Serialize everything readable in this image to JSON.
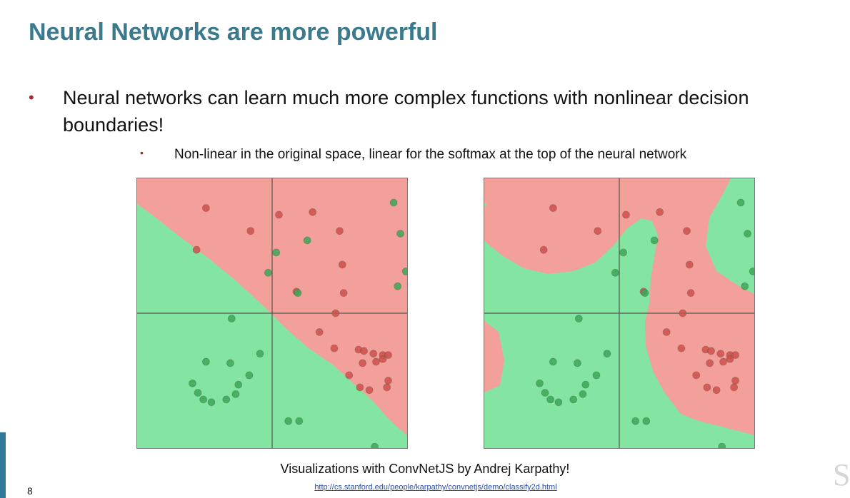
{
  "slide": {
    "title": "Neural Networks are more powerful",
    "bullet_main": "Neural networks can learn much more complex functions with nonlinear decision boundaries!",
    "bullet_sub": "Non-linear in the original space, linear for the softmax at the top of the neural network",
    "caption": "Visualizations with ConvNetJS by Andrej Karpathy!",
    "url": "http://cs.stanford.edu/people/karpathy/convnetjs/demo/classify2d.html",
    "page_number": "8",
    "corner_logo": "S"
  },
  "colors": {
    "title": "#3a7a8c",
    "red_region": "#f2a099",
    "green_region": "#84e5a2",
    "red_point": "#d0504a",
    "green_point": "#3aa856"
  },
  "chart_data": [
    {
      "type": "scatter",
      "title": "",
      "xlim": [
        -1,
        1
      ],
      "ylim": [
        -1,
        1
      ],
      "axes_lines": true,
      "decision_boundary": "linear",
      "series": [
        {
          "class": "red",
          "points": [
            [
              -0.49,
              0.78
            ],
            [
              -0.16,
              0.61
            ],
            [
              -0.56,
              0.47
            ],
            [
              0.05,
              0.73
            ],
            [
              0.3,
              0.75
            ],
            [
              0.5,
              0.61
            ],
            [
              0.52,
              0.36
            ],
            [
              0.53,
              0.15
            ],
            [
              0.18,
              0.16
            ],
            [
              0.47,
              0.0
            ],
            [
              0.35,
              -0.14
            ],
            [
              0.46,
              -0.26
            ],
            [
              0.64,
              -0.27
            ],
            [
              0.68,
              -0.28
            ],
            [
              0.75,
              -0.3
            ],
            [
              0.82,
              -0.31
            ],
            [
              0.86,
              -0.31
            ],
            [
              0.82,
              -0.34
            ],
            [
              0.77,
              -0.36
            ],
            [
              0.67,
              -0.37
            ],
            [
              0.86,
              -0.5
            ],
            [
              0.57,
              -0.46
            ],
            [
              0.65,
              -0.55
            ],
            [
              0.72,
              -0.57
            ],
            [
              0.85,
              -0.55
            ]
          ]
        },
        {
          "class": "green",
          "points": [
            [
              0.9,
              0.82
            ],
            [
              0.95,
              0.59
            ],
            [
              0.99,
              0.31
            ],
            [
              0.93,
              0.2
            ],
            [
              0.26,
              0.54
            ],
            [
              0.03,
              0.45
            ],
            [
              -0.03,
              0.3
            ],
            [
              0.19,
              0.15
            ],
            [
              -0.3,
              -0.04
            ],
            [
              -0.09,
              -0.3
            ],
            [
              -0.49,
              -0.36
            ],
            [
              -0.31,
              -0.37
            ],
            [
              -0.17,
              -0.46
            ],
            [
              -0.59,
              -0.52
            ],
            [
              -0.55,
              -0.59
            ],
            [
              -0.51,
              -0.64
            ],
            [
              -0.45,
              -0.66
            ],
            [
              -0.34,
              -0.64
            ],
            [
              -0.27,
              -0.6
            ],
            [
              -0.25,
              -0.53
            ],
            [
              0.12,
              -0.8
            ],
            [
              0.2,
              -0.8
            ],
            [
              0.76,
              -0.99
            ]
          ]
        }
      ]
    },
    {
      "type": "scatter",
      "title": "",
      "xlim": [
        -1,
        1
      ],
      "ylim": [
        -1,
        1
      ],
      "axes_lines": true,
      "decision_boundary": "nonlinear",
      "series": [
        {
          "class": "red",
          "points": [
            [
              -0.49,
              0.78
            ],
            [
              -0.16,
              0.61
            ],
            [
              -0.56,
              0.47
            ],
            [
              0.05,
              0.73
            ],
            [
              0.3,
              0.75
            ],
            [
              0.5,
              0.61
            ],
            [
              0.52,
              0.36
            ],
            [
              0.53,
              0.15
            ],
            [
              0.18,
              0.16
            ],
            [
              0.47,
              0.0
            ],
            [
              0.35,
              -0.14
            ],
            [
              0.46,
              -0.26
            ],
            [
              0.64,
              -0.27
            ],
            [
              0.68,
              -0.28
            ],
            [
              0.75,
              -0.3
            ],
            [
              0.82,
              -0.31
            ],
            [
              0.86,
              -0.31
            ],
            [
              0.82,
              -0.34
            ],
            [
              0.77,
              -0.36
            ],
            [
              0.67,
              -0.37
            ],
            [
              0.86,
              -0.5
            ],
            [
              0.57,
              -0.46
            ],
            [
              0.65,
              -0.55
            ],
            [
              0.72,
              -0.57
            ],
            [
              0.85,
              -0.55
            ]
          ]
        },
        {
          "class": "green",
          "points": [
            [
              0.9,
              0.82
            ],
            [
              0.95,
              0.59
            ],
            [
              0.99,
              0.31
            ],
            [
              0.93,
              0.2
            ],
            [
              0.26,
              0.54
            ],
            [
              0.03,
              0.45
            ],
            [
              -0.03,
              0.3
            ],
            [
              0.19,
              0.15
            ],
            [
              -0.3,
              -0.04
            ],
            [
              -0.09,
              -0.3
            ],
            [
              -0.49,
              -0.36
            ],
            [
              -0.31,
              -0.37
            ],
            [
              -0.17,
              -0.46
            ],
            [
              -0.59,
              -0.52
            ],
            [
              -0.55,
              -0.59
            ],
            [
              -0.51,
              -0.64
            ],
            [
              -0.45,
              -0.66
            ],
            [
              -0.34,
              -0.64
            ],
            [
              -0.27,
              -0.6
            ],
            [
              -0.25,
              -0.53
            ],
            [
              0.12,
              -0.8
            ],
            [
              0.2,
              -0.8
            ],
            [
              0.76,
              -0.99
            ]
          ]
        }
      ]
    }
  ]
}
